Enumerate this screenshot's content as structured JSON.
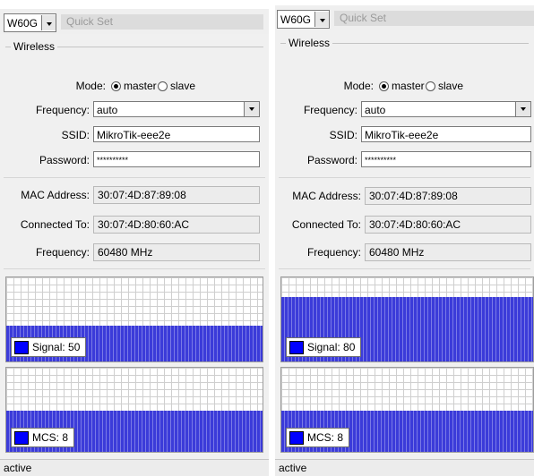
{
  "panels": [
    {
      "device": "W60G",
      "quick_set": "Quick Set",
      "group_title": "Wireless",
      "mode_label": "Mode:",
      "mode_master": "master",
      "mode_slave": "slave",
      "mode_selected": "master",
      "frequency_label": "Frequency:",
      "frequency_value": "auto",
      "ssid_label": "SSID:",
      "ssid_value": "MikroTik-eee2e",
      "password_label": "Password:",
      "password_value": "**********",
      "mac_label": "MAC Address:",
      "mac_value": "30:07:4D:87:89:08",
      "connected_label": "Connected To:",
      "connected_value": "30:07:4D:80:60:AC",
      "freq2_label": "Frequency:",
      "freq2_value": "60480 MHz",
      "signal_label": "Signal:",
      "signal_value": "50",
      "mcs_label": "MCS:",
      "mcs_value": "8",
      "status": "active"
    },
    {
      "device": "W60G",
      "quick_set": "Quick Set",
      "group_title": "Wireless",
      "mode_label": "Mode:",
      "mode_master": "master",
      "mode_slave": "slave",
      "mode_selected": "master",
      "frequency_label": "Frequency:",
      "frequency_value": "auto",
      "ssid_label": "SSID:",
      "ssid_value": "MikroTik-eee2e",
      "password_label": "Password:",
      "password_value": "**********",
      "mac_label": "MAC Address:",
      "mac_value": "30:07:4D:87:89:08",
      "connected_label": "Connected To:",
      "connected_value": "30:07:4D:80:60:AC",
      "freq2_label": "Frequency:",
      "freq2_value": "60480 MHz",
      "signal_label": "Signal:",
      "signal_value": "80",
      "mcs_label": "MCS:",
      "mcs_value": "8",
      "status": "active"
    }
  ],
  "colors": {
    "graph_fill": "#3b3bd9",
    "legend_swatch": "#0000ff"
  }
}
